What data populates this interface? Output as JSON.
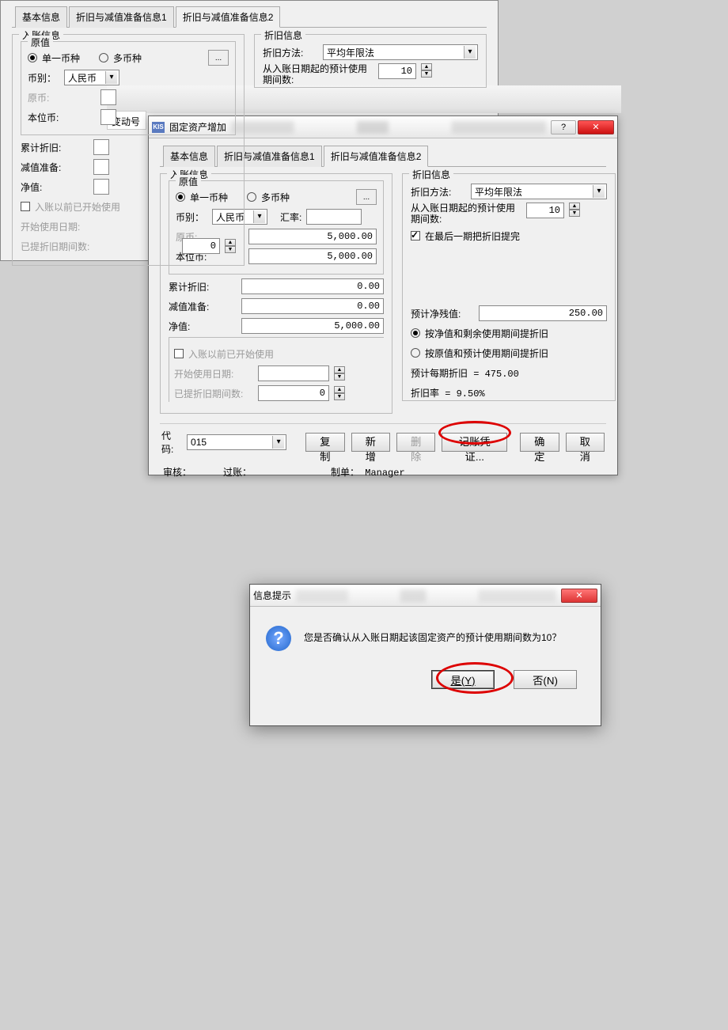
{
  "bg": {
    "col_header": "变动号"
  },
  "win1": {
    "icon": "KIS",
    "title": "固定资产增加",
    "tabs": {
      "t1": "基本信息",
      "t2": "折旧与减值准备信息1",
      "t3": "折旧与减值准备信息2"
    },
    "entry": {
      "legend": "入账信息",
      "original_legend": "原值",
      "single_currency": "单一币种",
      "multi_currency": "多币种",
      "currency_label": "币别：",
      "currency_value": "人民币",
      "rate_label": "汇率:",
      "rate_value": "",
      "orig_amt_label": "原币:",
      "orig_amt_value": "5,000.00",
      "base_amt_label": "本位币:",
      "base_amt_value": "5,000.00",
      "acc_depr_label": "累计折旧:",
      "acc_depr_value": "0.00",
      "impair_label": "减值准备:",
      "impair_value": "0.00",
      "net_label": "净值:",
      "net_value": "5,000.00",
      "used_before": "入账以前已开始使用",
      "start_date_label": "开始使用日期:",
      "start_date_value": "",
      "depr_periods_label": "已提折旧期间数:",
      "depr_periods_value": "0"
    },
    "depr": {
      "legend": "折旧信息",
      "method_label": "折旧方法:",
      "method_value": "平均年限法",
      "periods_label": "从入账日期起的预计使用期间数:",
      "periods_value": "10",
      "last_period_chk": "在最后一期把折旧提完",
      "salvage_label": "预计净残值:",
      "salvage_value": "250.00",
      "by_net": "按净值和剩余使用期间提折旧",
      "by_orig": "按原值和预计使用期间提折旧",
      "per_period": "预计每期折旧 = 475.00",
      "rate": "折旧率 = 9.50%"
    },
    "footer": {
      "code_label": "代码:",
      "code_value": "015",
      "copy": "复制",
      "new": "新增",
      "delete": "删除",
      "voucher": "记账凭证...",
      "ok": "确定",
      "cancel": "取消",
      "audit_label": "审核：",
      "post_label": "过账：",
      "maker_label": "制单：",
      "maker_value": "Manager"
    }
  },
  "modal": {
    "title": "信息提示",
    "message": "您是否确认从入账日期起该固定资产的预计使用期间数为10？",
    "yes": "是(Y)",
    "no": "否(N)"
  }
}
